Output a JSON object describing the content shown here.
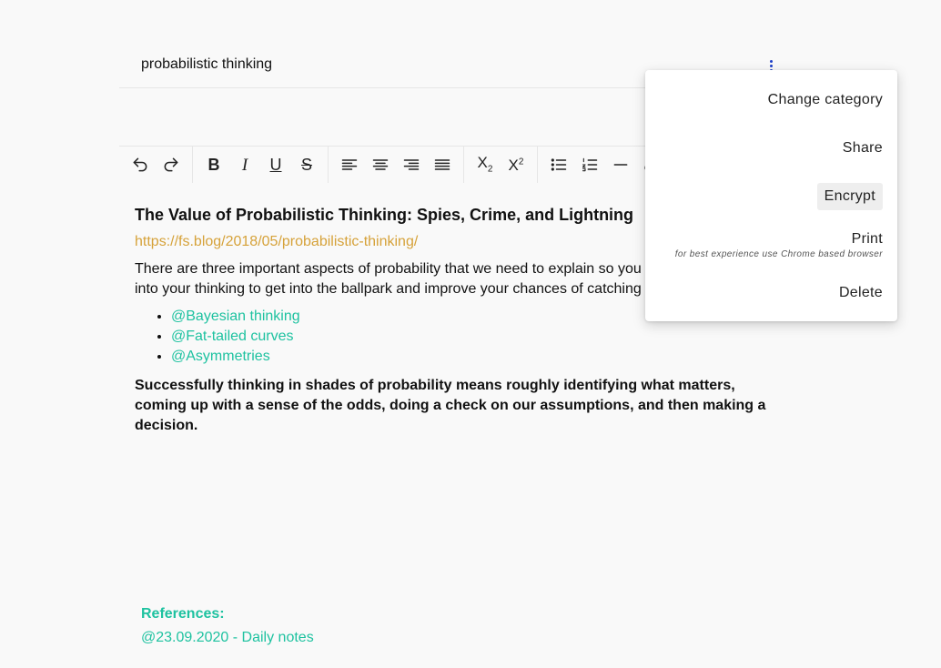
{
  "note": {
    "title": "probabilistic thinking"
  },
  "toolbar": {
    "groups": [
      [
        "undo-icon",
        "redo-icon"
      ],
      [
        "bold-icon",
        "italic-icon",
        "underline-icon",
        "strikethrough-icon"
      ],
      [
        "align-left-icon",
        "align-center-icon",
        "align-right-icon",
        "align-justify-icon"
      ],
      [
        "subscript-icon",
        "superscript-icon"
      ],
      [
        "bullet-list-icon",
        "numbered-list-icon",
        "horizontal-rule-icon",
        "link-icon"
      ]
    ]
  },
  "content": {
    "heading": "The Value of Probabilistic Thinking: Spies, Crime, and Lightning",
    "source_link": "https://fs.blog/2018/05/probabilistic-thinking/",
    "intro": "There are three important aspects of probability that we need to explain so you can integrate them into your thinking to get into the ballpark and improve your chances of catching the fish.",
    "bullets": [
      "@Bayesian thinking",
      "@Fat-tailed curves",
      "@Asymmetries"
    ],
    "conclusion": "Successfully thinking in shades of probability means roughly identifying what matters, coming up with a sense of the odds, doing a check on our assumptions, and then making a decision."
  },
  "references": {
    "label": "References:",
    "items": [
      "@23.09.2020 - Daily notes"
    ]
  },
  "menu": {
    "change_category": "Change category",
    "share": "Share",
    "encrypt": "Encrypt",
    "print": "Print",
    "print_hint": "for best experience use Chrome based browser",
    "delete": "Delete"
  },
  "colors": {
    "background": "#f9f9f9",
    "link_gold": "#d6a23a",
    "accent_teal": "#1ec2a0",
    "kebab_blue": "#1e40c8"
  }
}
